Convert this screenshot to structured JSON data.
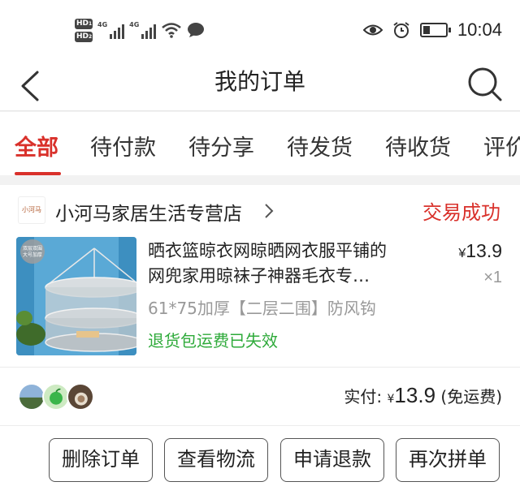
{
  "status_bar": {
    "sim1": "HD",
    "sim2": "HD",
    "sim_index_1": "1",
    "sim_index_2": "2",
    "network1": "4G",
    "network2": "4G",
    "time": "10:04",
    "battery_level": 0.3
  },
  "nav": {
    "title": "我的订单",
    "back_icon": "back-arrow-icon",
    "search_icon": "search-icon"
  },
  "tabs": [
    {
      "label": "全部",
      "active": true
    },
    {
      "label": "待付款"
    },
    {
      "label": "待分享"
    },
    {
      "label": "待发货"
    },
    {
      "label": "待收货"
    },
    {
      "label": "评价"
    }
  ],
  "order": {
    "shop_logo_text": "小河马",
    "shop_name": "小河马家居生活专营店",
    "status": "交易成功",
    "product": {
      "name_line1": "晒衣篮晾衣网晾晒网衣服平铺的",
      "name_line2": "网兜家用晾袜子神器毛衣专…",
      "image_badge": "双层双围大号加厚",
      "price_symbol": "¥",
      "price": "13.9",
      "quantity": "×1",
      "sku": "61*75加厚【二层二围】防风钩",
      "note": "退货包运费已失效"
    },
    "paid_label": "实付: ",
    "paid_symbol": "¥",
    "paid_amount": "13.9",
    "paid_suffix": " (免运费)",
    "actions": {
      "delete": "删除订单",
      "logistics": "查看物流",
      "refund": "申请退款",
      "rebuy": "再次拼单"
    }
  },
  "colors": {
    "accent": "#d9312b",
    "green_note": "#2eaa3a"
  }
}
